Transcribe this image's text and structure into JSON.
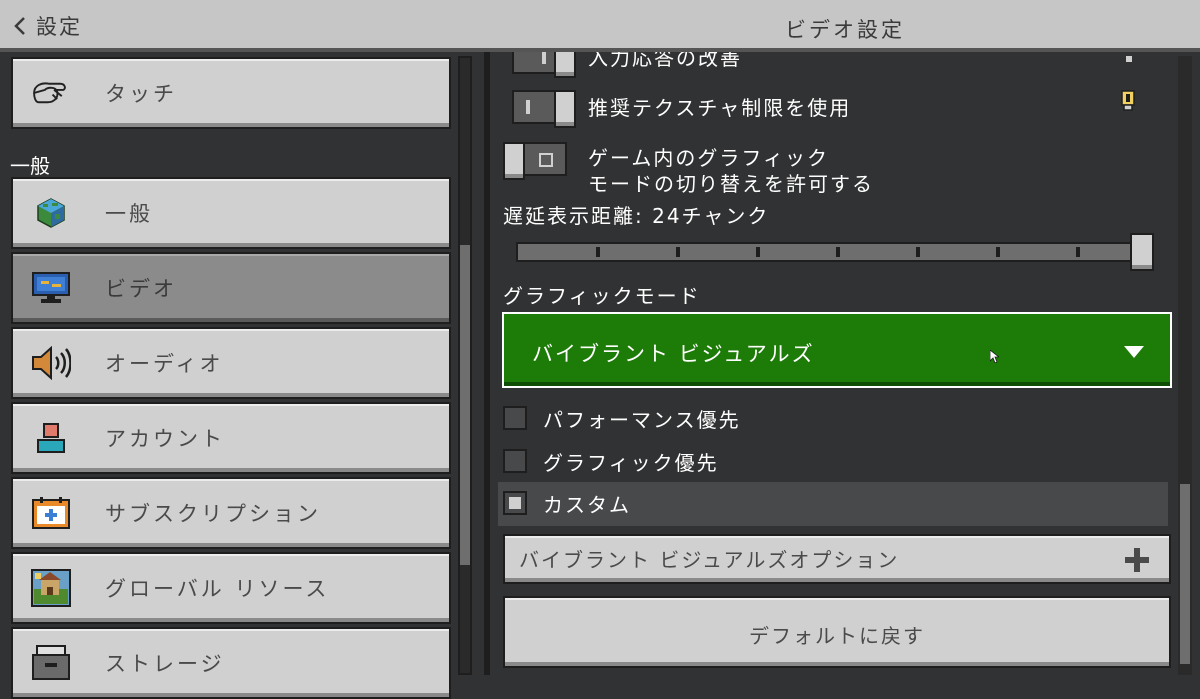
{
  "header": {
    "back_label": "設定",
    "title": "ビデオ設定"
  },
  "sidebar": {
    "section_general": "一般",
    "items": [
      {
        "label": "タッチ",
        "icon": "touch-hand-icon"
      },
      {
        "label": "一般",
        "icon": "globe-cube-icon"
      },
      {
        "label": "ビデオ",
        "icon": "monitor-icon",
        "selected": true
      },
      {
        "label": "オーディオ",
        "icon": "speaker-icon"
      },
      {
        "label": "アカウント",
        "icon": "account-person-icon"
      },
      {
        "label": "サブスクリプション",
        "icon": "calendar-plus-icon"
      },
      {
        "label": "グローバル リソース",
        "icon": "resource-pack-icon"
      },
      {
        "label": "ストレージ",
        "icon": "storage-box-icon"
      }
    ]
  },
  "settings": {
    "input_response_label": "入力応答の改善",
    "recommended_texture_label": "推奨テクスチャ制限を使用",
    "graphics_switch_line1": "ゲーム内のグラフィック",
    "graphics_switch_line2": "モードの切り替えを許可する",
    "render_distance_label": "遅延表示距離: 24チャンク",
    "render_distance_fraction": 1.0,
    "graphics_mode_label": "グラフィックモード",
    "graphics_mode_value": "バイブラント ビジュアルズ",
    "radio_options": [
      {
        "label": "パフォーマンス優先",
        "checked": false
      },
      {
        "label": "グラフィック優先",
        "checked": false
      },
      {
        "label": "カスタム",
        "checked": true
      }
    ],
    "vv_options_label": "バイブラント ビジュアルズオプション",
    "reset_label": "デフォルトに戻す"
  },
  "colors": {
    "dropdown_green": "#1d7b08",
    "panel_gray": "#d0d0d0",
    "background": "#313233"
  }
}
